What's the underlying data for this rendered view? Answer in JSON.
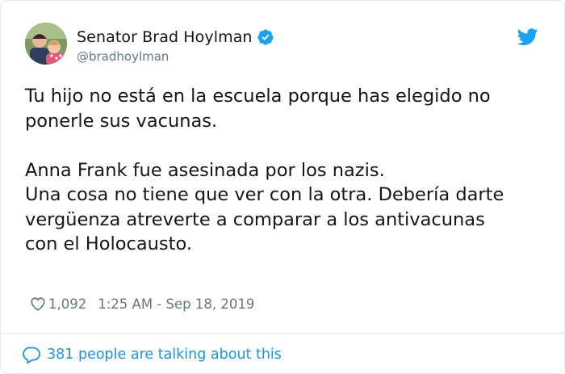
{
  "author": {
    "display_name": "Senator Brad Hoylman",
    "handle": "@bradhoylman",
    "verified": true,
    "avatar_icon": "profile-photo"
  },
  "tweet": {
    "text": "Tu hijo no está en la escuela porque has elegido no\nponerle sus vacunas.\n\nAnna Frank fue asesinada por los nazis.\nUna cosa no tiene que ver con la otra. Debería darte\nvergüenza atreverte a comparar a los antivacunas\ncon el Holocausto.",
    "likes": "1,092",
    "timestamp": "1:25 AM - Sep 18, 2019"
  },
  "footer": {
    "conversation_label": "381 people are talking about this"
  },
  "colors": {
    "text": "#14171a",
    "secondary": "#657786",
    "brand_blue": "#1da1f2",
    "link_blue": "#1b95e0",
    "border": "#e1e8ed"
  },
  "icons": [
    "verified-badge-icon",
    "twitter-bird-icon",
    "heart-icon",
    "speech-bubble-icon"
  ]
}
